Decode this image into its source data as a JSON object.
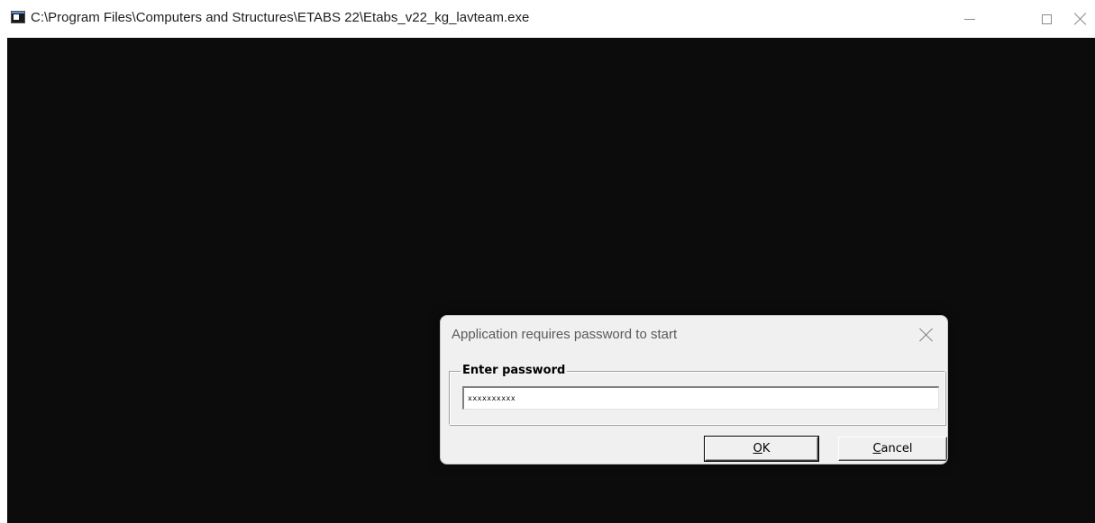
{
  "window": {
    "title": "C:\\Program Files\\Computers and Structures\\ETABS 22\\Etabs_v22_kg_lavteam.exe",
    "background_color": "#0c0c0c"
  },
  "dialog": {
    "title": "Application requires password to start",
    "group_label": "Enter password",
    "password_value": "xxxxxxxxxx",
    "ok_mnemonic": "O",
    "ok_rest": "K",
    "cancel_mnemonic": "C",
    "cancel_rest": "ancel"
  },
  "icons": [
    "console-app-icon",
    "minimize-icon",
    "maximize-icon",
    "close-icon",
    "dialog-close-icon"
  ]
}
